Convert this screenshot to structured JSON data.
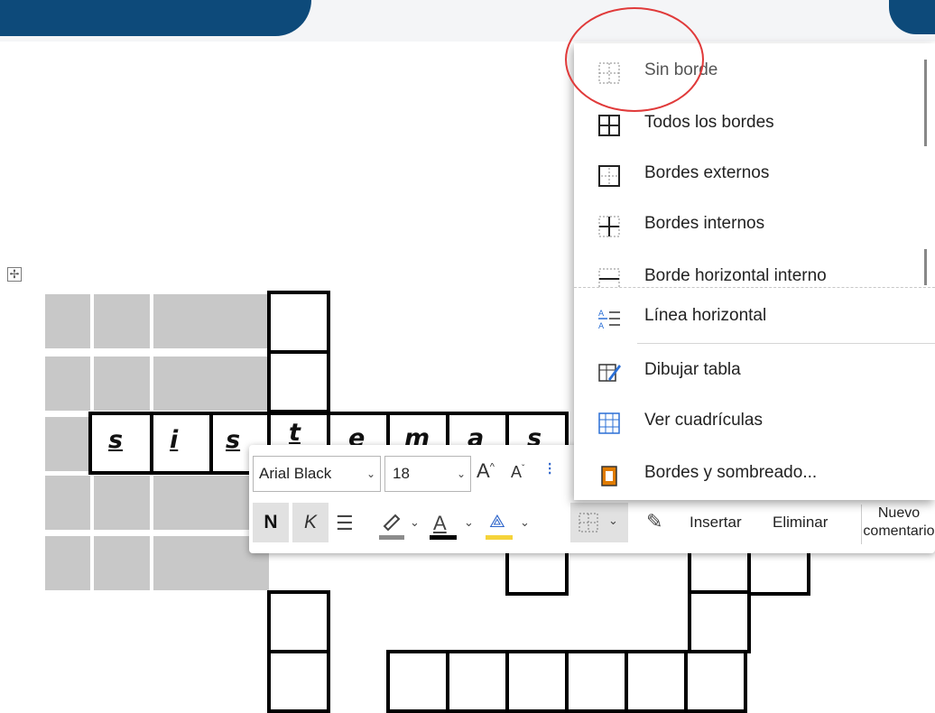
{
  "crossword": {
    "letters": [
      "s",
      "i",
      "s",
      "t",
      "e",
      "m",
      "a",
      "s"
    ]
  },
  "mini_toolbar": {
    "font_name": "Arial Black",
    "font_size": "18",
    "bold_label": "N",
    "italic_label": "K",
    "insert_label": "Insertar",
    "delete_label": "Eliminar",
    "new_comment_label_1": "Nuevo",
    "new_comment_label_2": "comentario",
    "highlight_color": "#8c8c8c",
    "font_color": "#000000",
    "shading_color": "#f5d33a"
  },
  "borders_menu": {
    "items": [
      {
        "label": "Sin borde",
        "icon": "no-border-icon"
      },
      {
        "label": "Todos los bordes",
        "icon": "all-borders-icon"
      },
      {
        "label": "Bordes externos",
        "icon": "outside-borders-icon"
      },
      {
        "label": "Bordes internos",
        "icon": "inside-borders-icon"
      },
      {
        "label": "Borde horizontal interno",
        "icon": "inside-horizontal-border-icon"
      },
      {
        "label": "Línea horizontal",
        "icon": "horizontal-line-icon"
      },
      {
        "label": "Dibujar tabla",
        "icon": "draw-table-icon"
      },
      {
        "label": "Ver cuadrículas",
        "icon": "view-gridlines-icon"
      },
      {
        "label": "Bordes y sombreado...",
        "icon": "borders-shading-icon"
      }
    ]
  },
  "colors": {
    "header_accent": "#0d4a7a",
    "annotation": "#e03a3a",
    "gridlines_icon": "#2a6fd6",
    "shading_icon": "#e07b00"
  }
}
